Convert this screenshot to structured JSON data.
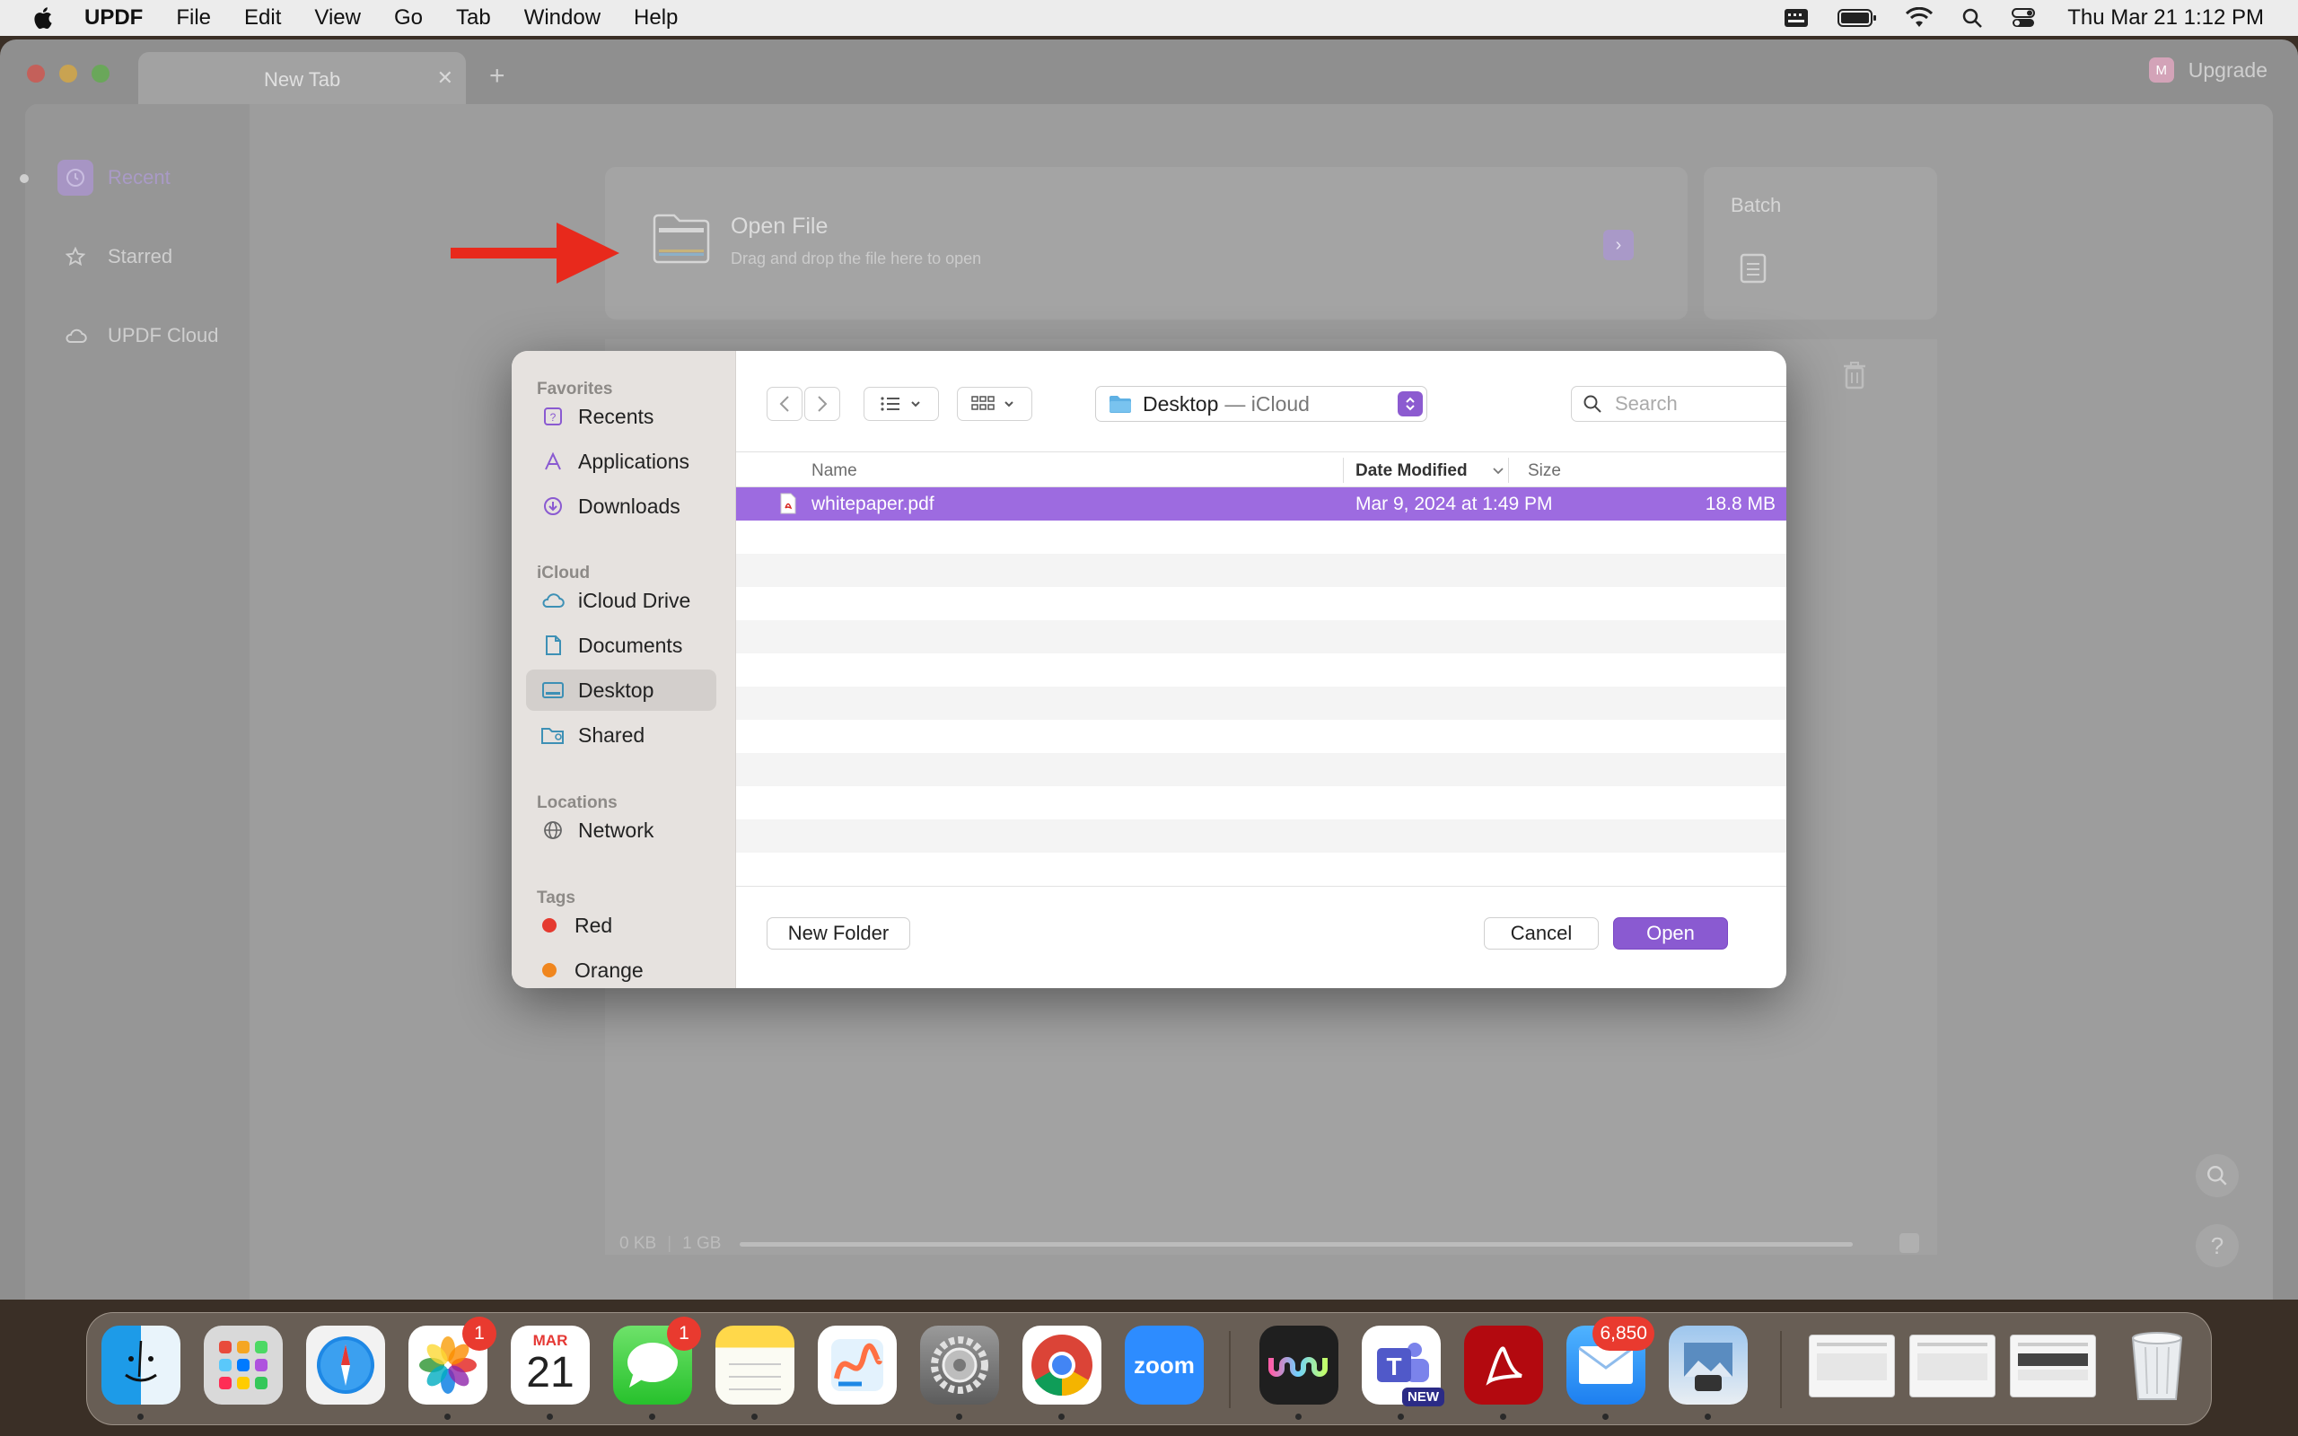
{
  "menubar": {
    "app_name": "UPDF",
    "items": [
      "File",
      "Edit",
      "View",
      "Go",
      "Tab",
      "Window",
      "Help"
    ],
    "clock": "Thu Mar 21  1:12 PM"
  },
  "window": {
    "tab_label": "New Tab",
    "upgrade_badge": "M",
    "upgrade_label": "Upgrade"
  },
  "sidebar": {
    "items": [
      {
        "label": "Recent",
        "icon": "clock-icon"
      },
      {
        "label": "Starred",
        "icon": "star-icon"
      },
      {
        "label": "UPDF Cloud",
        "icon": "cloud-icon"
      }
    ]
  },
  "open_file": {
    "title": "Open File",
    "subtitle": "Drag and drop the file here to open"
  },
  "batch": {
    "title": "Batch"
  },
  "storage": {
    "used": "0 KB",
    "total": "1 GB",
    "fraction": 0.0
  },
  "dialog": {
    "sections": {
      "favorites": "Favorites",
      "icloud": "iCloud",
      "locations": "Locations",
      "tags": "Tags"
    },
    "favorites": [
      "Recents",
      "Applications",
      "Downloads"
    ],
    "icloud_items": [
      "iCloud Drive",
      "Documents",
      "Desktop",
      "Shared"
    ],
    "locations": [
      "Network"
    ],
    "tags": [
      {
        "label": "Red",
        "color": "#e53a2f"
      },
      {
        "label": "Orange",
        "color": "#f0861e"
      }
    ],
    "location": {
      "name": "Desktop",
      "sub": "— iCloud"
    },
    "search_placeholder": "Search",
    "columns": {
      "name": "Name",
      "date": "Date Modified",
      "size": "Size"
    },
    "files": [
      {
        "name": "whitepaper.pdf",
        "date": "Mar 9, 2024 at 1:49 PM",
        "size": "18.8 MB",
        "selected": true
      }
    ],
    "buttons": {
      "new_folder": "New Folder",
      "cancel": "Cancel",
      "open": "Open"
    }
  },
  "dock": {
    "calendar": {
      "month": "MAR",
      "day": "21"
    },
    "photos_badge": "1",
    "messages_badge": "1",
    "mail_badge": "6,850",
    "zoom_label": "zoom",
    "teams_label": "NEW"
  },
  "colors": {
    "accent": "#8a5ad1",
    "selection": "#9d6be0",
    "arrow": "#e8291c"
  }
}
